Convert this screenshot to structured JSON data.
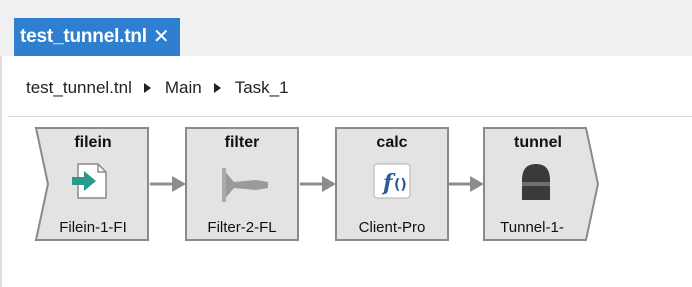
{
  "tab": {
    "label": "test_tunnel.tnl",
    "close_glyph": "✕"
  },
  "breadcrumb": [
    {
      "label": "test_tunnel.tnl"
    },
    {
      "label": "Main"
    },
    {
      "label": "Task_1"
    }
  ],
  "nodes": [
    {
      "title": "filein",
      "label": "Filein-1-FI",
      "icon": "file-import-icon"
    },
    {
      "title": "filter",
      "label": "Filter-2-FL",
      "icon": "funnel-icon"
    },
    {
      "title": "calc",
      "label": "Client-Pro",
      "icon": "function-icon",
      "icon_text": "f",
      "icon_parens": "()"
    },
    {
      "title": "tunnel",
      "label": "Tunnel-1-",
      "icon": "tunnel-icon"
    }
  ],
  "colors": {
    "tab": "#2f7fd1",
    "node_fill": "#e3e3e3",
    "node_border": "#8a8a8a",
    "connector": "#8c8c8c"
  }
}
